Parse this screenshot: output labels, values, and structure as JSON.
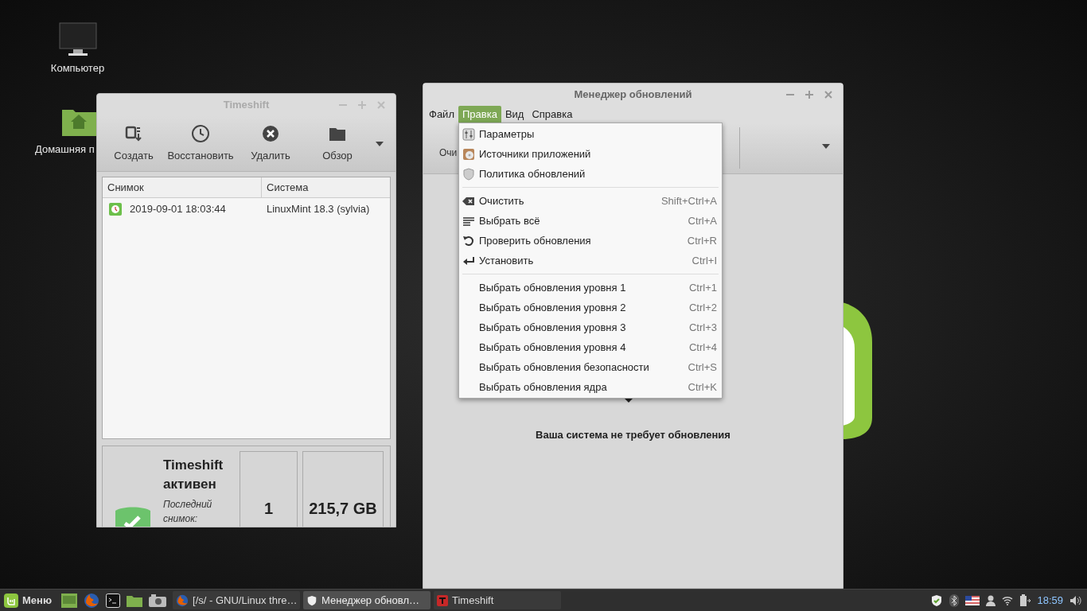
{
  "desktop_icons": [
    {
      "label": "Компьютер"
    },
    {
      "label": "Домашняя п"
    }
  ],
  "timeshift": {
    "title": "Timeshift",
    "toolbar": [
      {
        "label": "Создать"
      },
      {
        "label": "Восстановить"
      },
      {
        "label": "Удалить"
      },
      {
        "label": "Обзор"
      }
    ],
    "table": {
      "columns": [
        "Снимок",
        "Система"
      ],
      "rows": [
        {
          "date": "2019-09-01 18:03:44",
          "system": "LinuxMint 18.3 (sylvia)"
        }
      ]
    },
    "status": {
      "title": "Timeshift активен",
      "subtitle": "Последний снимок:",
      "count": "1",
      "size": "215,7 GB"
    }
  },
  "update_manager": {
    "title": "Менеджер обновлений",
    "menubar": [
      {
        "label": "Файл",
        "selected": false
      },
      {
        "label": "Правка",
        "selected": true
      },
      {
        "label": "Вид",
        "selected": false
      },
      {
        "label": "Справка",
        "selected": false
      }
    ],
    "toolbar_text": "Очи",
    "message": "Ваша система не требует обновления",
    "menu": {
      "sections": [
        [
          {
            "label": "Параметры"
          },
          {
            "label": "Источники приложений"
          },
          {
            "label": "Политика обновлений"
          }
        ],
        [
          {
            "label": "Очистить",
            "shortcut": "Shift+Ctrl+A"
          },
          {
            "label": "Выбрать всё",
            "shortcut": "Ctrl+A"
          },
          {
            "label": "Проверить обновления",
            "shortcut": "Ctrl+R"
          },
          {
            "label": "Установить",
            "shortcut": "Ctrl+I"
          }
        ],
        [
          {
            "label": "Выбрать обновления уровня 1",
            "shortcut": "Ctrl+1"
          },
          {
            "label": "Выбрать обновления уровня 2",
            "shortcut": "Ctrl+2"
          },
          {
            "label": "Выбрать обновления уровня 3",
            "shortcut": "Ctrl+3"
          },
          {
            "label": "Выбрать обновления уровня 4",
            "shortcut": "Ctrl+4"
          },
          {
            "label": "Выбрать обновления безопасности",
            "shortcut": "Ctrl+S"
          },
          {
            "label": "Выбрать обновления ядра",
            "shortcut": "Ctrl+K"
          }
        ]
      ]
    }
  },
  "taskbar": {
    "menu_label": "Меню",
    "windows": [
      {
        "title": "[/s/ - GNU/Linux thre…",
        "selected": false
      },
      {
        "title": "Менеджер обновл…",
        "selected": true
      },
      {
        "title": "Timeshift",
        "selected": false
      }
    ],
    "clock": "18:59"
  }
}
